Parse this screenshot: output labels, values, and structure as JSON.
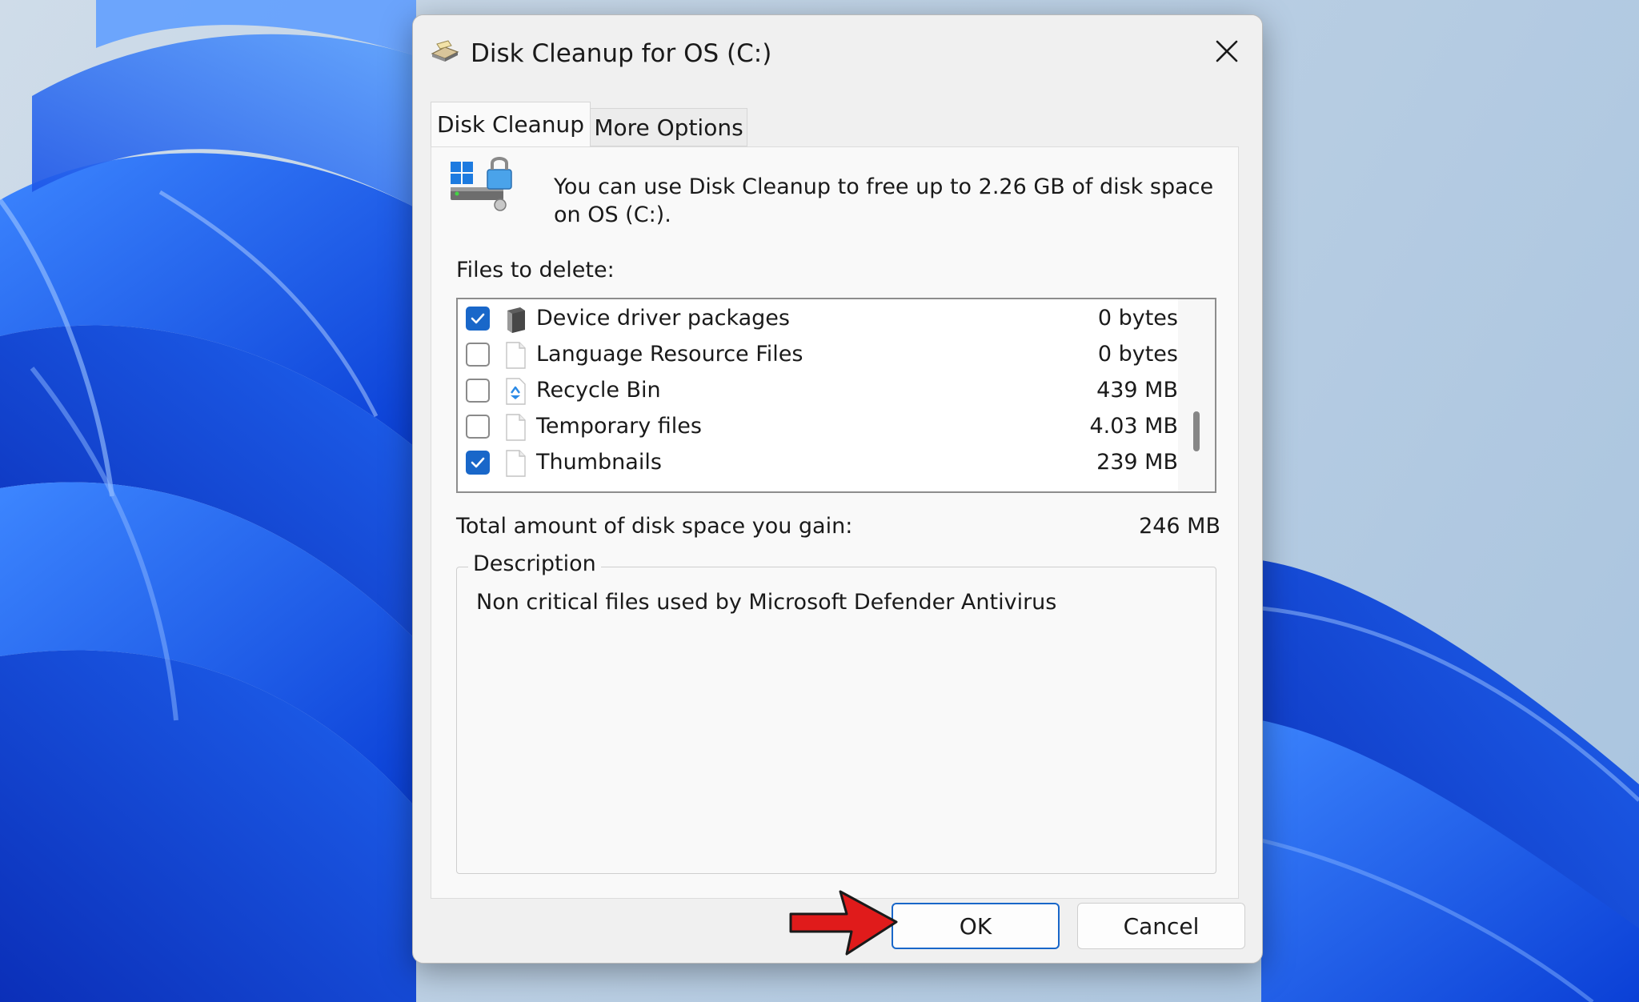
{
  "window": {
    "title": "Disk Cleanup for OS (C:)",
    "close_icon": "close-icon"
  },
  "tabs": [
    {
      "label": "Disk Cleanup",
      "active": true
    },
    {
      "label": "More Options",
      "active": false
    }
  ],
  "intro": {
    "text": "You can use Disk Cleanup to free up to 2.26 GB of disk space on OS (C:)."
  },
  "files": {
    "label": "Files to delete:",
    "items": [
      {
        "name": "Device driver packages",
        "size": "0 bytes",
        "checked": true,
        "icon": "driver-icon"
      },
      {
        "name": "Language Resource Files",
        "size": "0 bytes",
        "checked": false,
        "icon": "file-icon"
      },
      {
        "name": "Recycle Bin",
        "size": "439 MB",
        "checked": false,
        "icon": "recycle-bin-icon"
      },
      {
        "name": "Temporary files",
        "size": "4.03 MB",
        "checked": false,
        "icon": "file-icon"
      },
      {
        "name": "Thumbnails",
        "size": "239 MB",
        "checked": true,
        "icon": "file-icon"
      }
    ]
  },
  "total": {
    "label": "Total amount of disk space you gain:",
    "value": "246 MB"
  },
  "description": {
    "legend": "Description",
    "text": "Non critical files used by Microsoft Defender Antivirus"
  },
  "buttons": {
    "ok": "OK",
    "cancel": "Cancel"
  },
  "colors": {
    "accent": "#1967c9",
    "annotation_arrow": "#e01b1b"
  }
}
